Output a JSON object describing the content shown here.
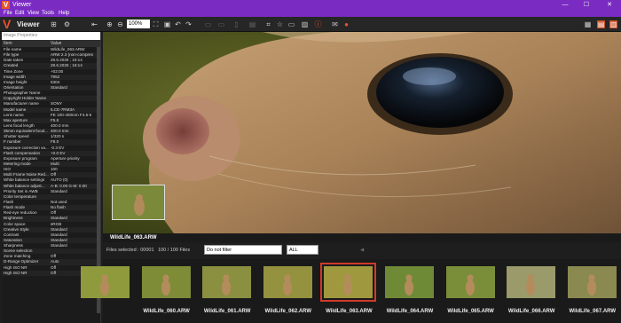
{
  "window": {
    "title": "Viewer",
    "logo": "V",
    "minimize": "—",
    "maximize": "☐",
    "close": "✕"
  },
  "menu": [
    "File",
    "Edit",
    "View",
    "Tools",
    "Help"
  ],
  "toolbar": {
    "brand": "Viewer",
    "zoom": "100%"
  },
  "properties": {
    "title": "Image Properties",
    "col_item": "Item",
    "col_value": "Value",
    "rows": [
      [
        "File name",
        "WildLife_063.ARW"
      ],
      [
        "File type",
        "ARW 2.3 (non-compres"
      ],
      [
        "Date taken",
        "28.6.2025 ; 16:14"
      ],
      [
        "Created",
        "28.6.2025 ; 16:14"
      ],
      [
        "Time Zone",
        "+02:00"
      ],
      [
        "Image width",
        "7952"
      ],
      [
        "Image height",
        "5304"
      ],
      [
        "Orientation",
        "Standard"
      ],
      [
        "Photographer Name",
        ""
      ],
      [
        "Copyright Holder Name",
        ""
      ],
      [
        "Manufacturer name",
        "SONY"
      ],
      [
        "Model name",
        "ILCE-7RM3A"
      ],
      [
        "Lens name",
        "FE 100-400mm F4.5-5"
      ],
      [
        "Max aperture",
        "F5.6"
      ],
      [
        "Lens focal length",
        "400.0 mm"
      ],
      [
        "35mm equivalent focal...",
        "400.0 mm"
      ],
      [
        "Shutter speed",
        "1/320 s"
      ],
      [
        "F number",
        "F8.0"
      ],
      [
        "Exposure correction va...",
        "-0.3 EV"
      ],
      [
        "Flash compensation",
        "+0.0 EV"
      ],
      [
        "Exposure program",
        "Aperture priority"
      ],
      [
        "Metering mode",
        "Multi"
      ],
      [
        "ISO",
        "100"
      ],
      [
        "Multi Frame Noise Red...",
        "Off"
      ],
      [
        "White balance settings",
        "AUTO (0)"
      ],
      [
        "White balance adjust...",
        "A-B: 0.00 G-M: 0.00"
      ],
      [
        "Priority Set in AWB",
        "Standard"
      ],
      [
        "Color temperature",
        ""
      ],
      [
        "Flash",
        "Not used"
      ],
      [
        "Flash mode",
        "No flash"
      ],
      [
        "Red-eye reduction",
        "Off"
      ],
      [
        "Brightness",
        "Standard"
      ],
      [
        "Color space",
        "sRGB"
      ],
      [
        "Creative Style",
        "Standard"
      ],
      [
        "Contrast",
        "Standard"
      ],
      [
        "Saturation",
        "Standard"
      ],
      [
        "Sharpness",
        "Standard"
      ],
      [
        "Scene selection",
        ""
      ],
      [
        "Zone matching",
        "Off"
      ],
      [
        "D-Range Optimizer",
        "Auto"
      ],
      [
        "High ISO NR",
        "Off"
      ],
      [
        "High ISO NR",
        "Off"
      ]
    ]
  },
  "viewer": {
    "caption": "WildLife_063.ARW"
  },
  "filter": {
    "files_selected": "Files selected : 00001",
    "count": "100 / 100 Files",
    "filter_value": "Do not filter",
    "all_value": "ALL"
  },
  "filmstrip": [
    {
      "label": ""
    },
    {
      "label": "WildLife_060.ARW"
    },
    {
      "label": "WildLife_061.ARW"
    },
    {
      "label": "WildLife_062.ARW"
    },
    {
      "label": "WildLife_063.ARW"
    },
    {
      "label": "WildLife_064.ARW"
    },
    {
      "label": "WildLife_065.ARW"
    },
    {
      "label": "WildLife_066.ARW"
    },
    {
      "label": "WildLife_067.ARW"
    }
  ],
  "colors": {
    "titlebar": "#7a2bc2",
    "accent": "#e8542a",
    "selection": "#d03a2a"
  }
}
